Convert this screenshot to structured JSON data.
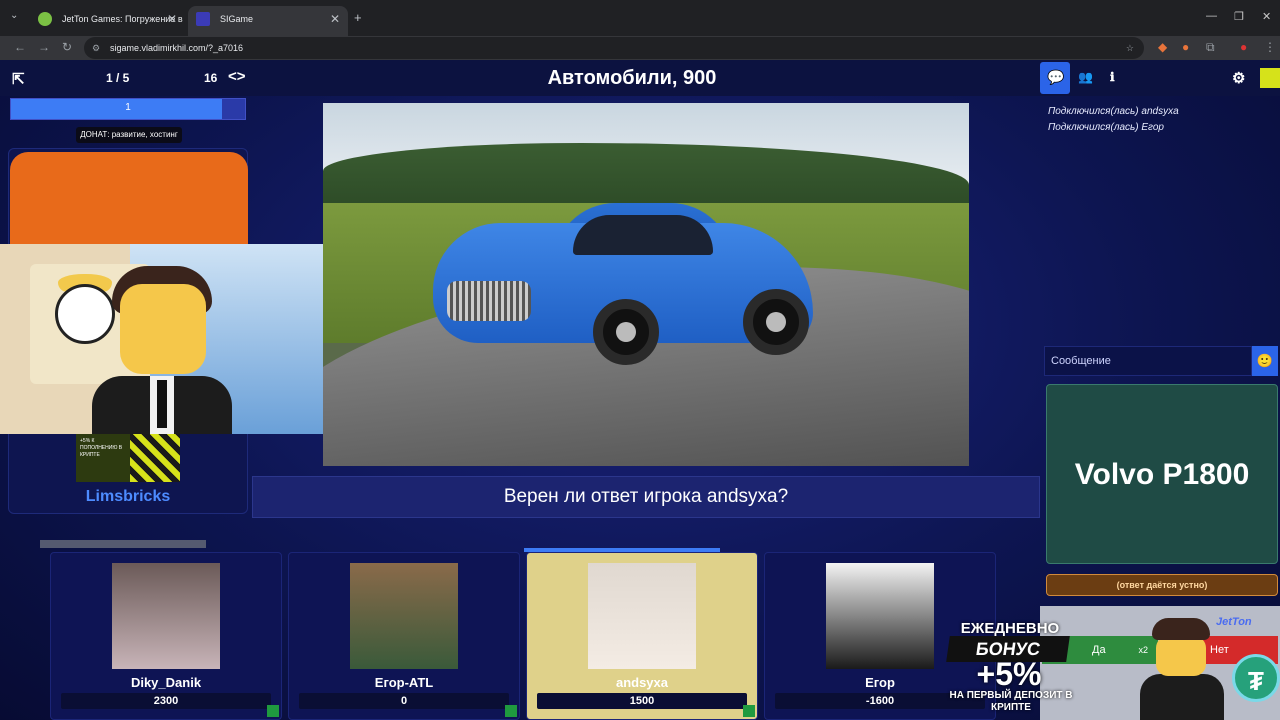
{
  "browser": {
    "tabs": [
      {
        "title": "JetTon Games: Погружение в ...",
        "active": false
      },
      {
        "title": "SIGame",
        "active": true
      }
    ],
    "url": "sigame.vladimirkhil.com/?_a7016"
  },
  "game": {
    "round": "1 / 5",
    "count": "16",
    "theme_title": "Автомобили, 900",
    "progress_value": "1",
    "progress_fraction": 0.9,
    "donat_label": "ДОНАТ: развитие, хостинг",
    "host_name": "Limsbricks",
    "question_text": "Верен ли ответ игрока andsyxa?"
  },
  "players": [
    {
      "name": "Diky_Danik",
      "score": "2300",
      "active": false
    },
    {
      "name": "Егор-ATL",
      "score": "0",
      "active": false
    },
    {
      "name": "andsyxa",
      "score": "1500",
      "active": true
    },
    {
      "name": "Егор",
      "score": "-1600",
      "active": false
    }
  ],
  "chat": {
    "messages": [
      "Подключился(лась) andsyxa",
      "Подключился(лась) Егор"
    ],
    "placeholder": "Сообщение"
  },
  "answer": {
    "text": "Volvo P1800",
    "mode": "(ответ даётся устно)",
    "yes_label": "Да",
    "no_label": "Нет",
    "yes_mult": "x2"
  },
  "ad": {
    "line1": "ЕЖЕДНЕВНО",
    "line2": "БОНУС",
    "line3": "+5%",
    "line4": "НА ПЕРВЫЙ ДЕПОЗИТ В КРИПТЕ",
    "brand": "JetTon",
    "promo_text": "+5% К ПОПОЛНЕНИЮ В КРИПТЕ"
  },
  "colors": {
    "accent": "#2b64e8",
    "answer_bg": "#1f4b45",
    "active_player": "#dfd18a"
  }
}
